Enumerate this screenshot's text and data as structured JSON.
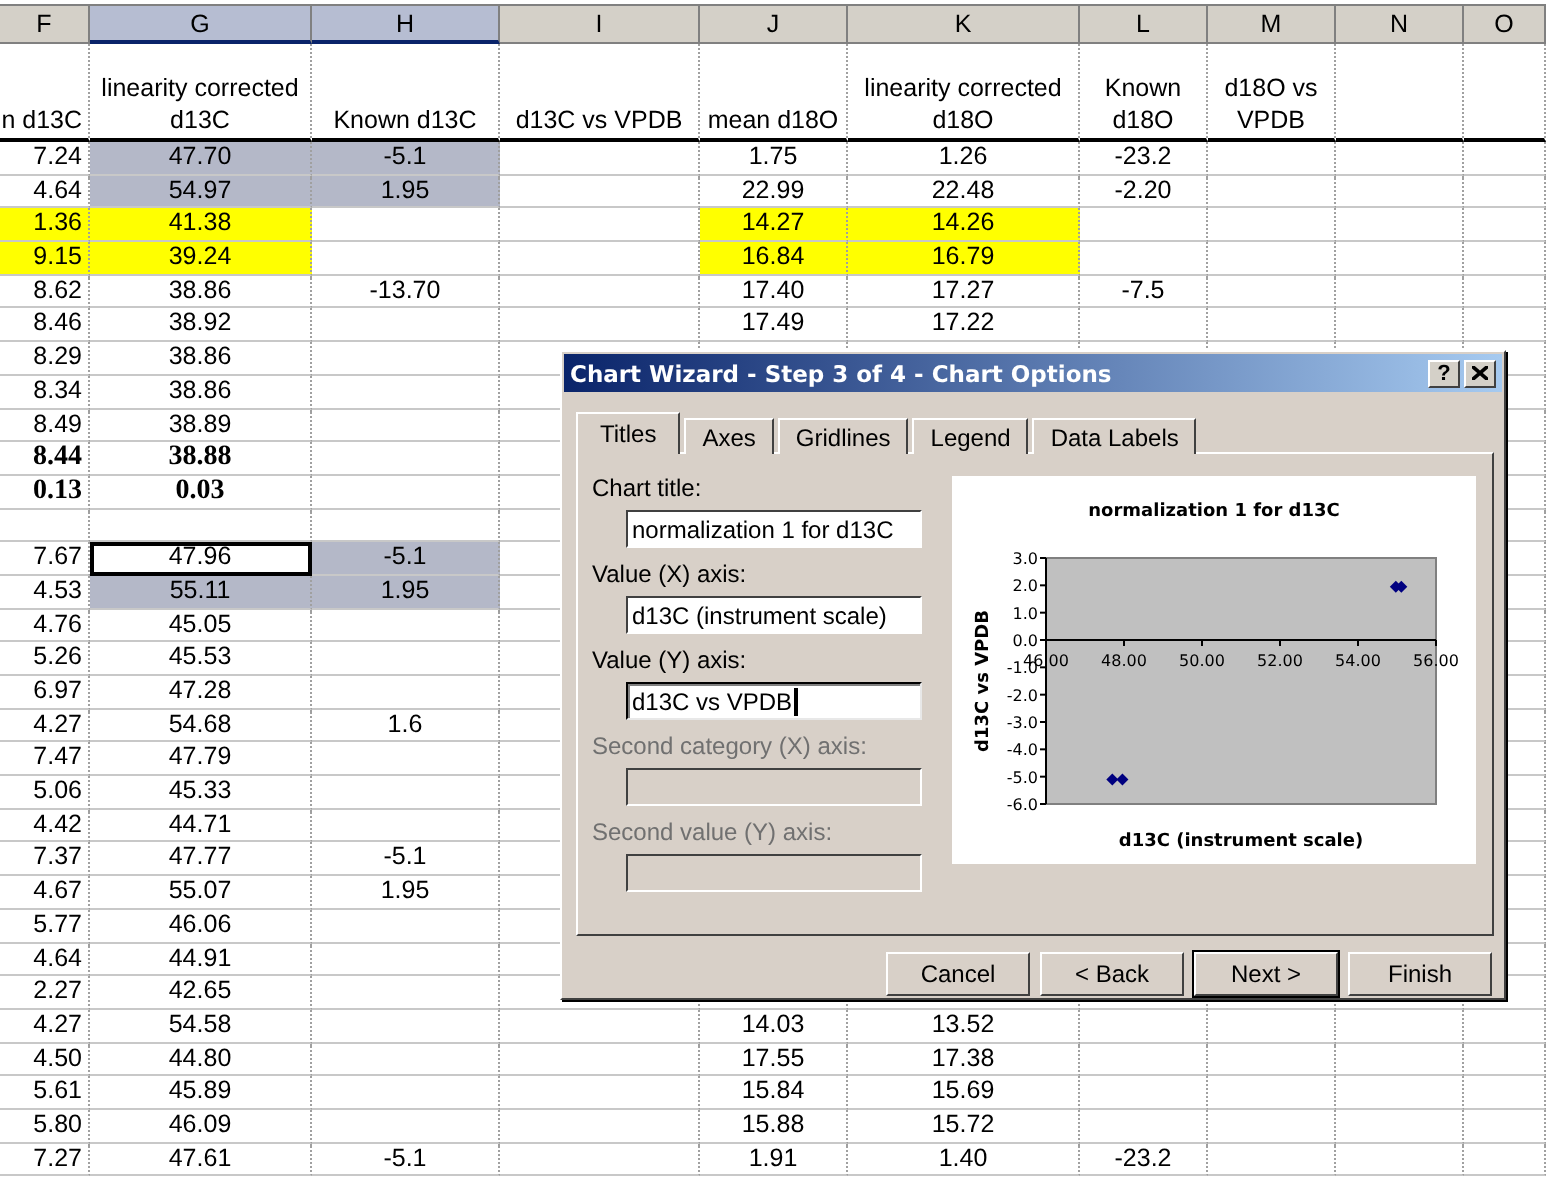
{
  "sheet": {
    "columns": [
      {
        "label": "F",
        "selected": false
      },
      {
        "label": "G",
        "selected": true
      },
      {
        "label": "H",
        "selected": true
      },
      {
        "label": "I",
        "selected": false
      },
      {
        "label": "J",
        "selected": false
      },
      {
        "label": "K",
        "selected": false
      },
      {
        "label": "L",
        "selected": false
      },
      {
        "label": "M",
        "selected": false
      },
      {
        "label": "N",
        "selected": false
      },
      {
        "label": "O",
        "selected": false
      }
    ],
    "headings": {
      "F": "n d13C",
      "G": "linearity corrected d13C",
      "H": "Known d13C",
      "I": "d13C vs VPDB",
      "J": "mean d18O",
      "K": "linearity corrected d18O",
      "L": "Known d18O",
      "M": "d18O vs VPDB"
    },
    "rows": [
      {
        "kind": "data",
        "cells": {
          "F": {
            "text": "7.24"
          },
          "G": {
            "text": "47.70",
            "in_range": true
          },
          "H": {
            "text": "-5.1",
            "in_range": true
          },
          "J": {
            "text": "1.75"
          },
          "K": {
            "text": "1.26"
          },
          "L": {
            "text": "-23.2"
          }
        }
      },
      {
        "kind": "data",
        "cells": {
          "F": {
            "text": "4.64"
          },
          "G": {
            "text": "54.97",
            "in_range": true
          },
          "H": {
            "text": "1.95",
            "in_range": true
          },
          "J": {
            "text": "22.99"
          },
          "K": {
            "text": "22.48"
          },
          "L": {
            "text": "-2.20"
          }
        }
      },
      {
        "kind": "data",
        "cells": {
          "F": {
            "text": "1.36",
            "color": "#ffff00"
          },
          "G": {
            "text": "41.38",
            "color": "#ffff00"
          },
          "J": {
            "text": "14.27",
            "color": "#ffff00"
          },
          "K": {
            "text": "14.26",
            "color": "#ffff00"
          }
        }
      },
      {
        "kind": "data",
        "cells": {
          "F": {
            "text": "9.15",
            "color": "#ffff00"
          },
          "G": {
            "text": "39.24",
            "color": "#ffff00"
          },
          "J": {
            "text": "16.84",
            "color": "#ffff00"
          },
          "K": {
            "text": "16.79",
            "color": "#ffff00"
          }
        }
      },
      {
        "kind": "data",
        "cells": {
          "F": {
            "text": "8.62"
          },
          "G": {
            "text": "38.86"
          },
          "H": {
            "text": "-13.70"
          },
          "J": {
            "text": "17.40"
          },
          "K": {
            "text": "17.27"
          },
          "L": {
            "text": "-7.5"
          }
        }
      },
      {
        "kind": "data",
        "cells": {
          "F": {
            "text": "8.46"
          },
          "G": {
            "text": "38.92"
          },
          "J": {
            "text": "17.49"
          },
          "K": {
            "text": "17.22"
          }
        }
      },
      {
        "kind": "data",
        "cells": {
          "F": {
            "text": "8.29"
          },
          "G": {
            "text": "38.86"
          }
        }
      },
      {
        "kind": "data",
        "cells": {
          "F": {
            "text": "8.34"
          },
          "G": {
            "text": "38.86"
          }
        }
      },
      {
        "kind": "data",
        "cells": {
          "F": {
            "text": "8.49"
          },
          "G": {
            "text": "38.89"
          }
        }
      },
      {
        "kind": "bold",
        "cells": {
          "F": {
            "text": "8.44"
          },
          "G": {
            "text": "38.88"
          }
        }
      },
      {
        "kind": "bold",
        "cells": {
          "F": {
            "text": "0.13"
          },
          "G": {
            "text": "0.03"
          }
        }
      },
      {
        "kind": "blank"
      },
      {
        "kind": "data",
        "cells": {
          "F": {
            "text": "7.67"
          },
          "G": {
            "text": "47.96",
            "active": true
          },
          "H": {
            "text": "-5.1",
            "in_range": true
          }
        }
      },
      {
        "kind": "data",
        "cells": {
          "F": {
            "text": "4.53"
          },
          "G": {
            "text": "55.11",
            "in_range": true
          },
          "H": {
            "text": "1.95",
            "in_range": true
          }
        }
      },
      {
        "kind": "data",
        "cells": {
          "F": {
            "text": "4.76"
          },
          "G": {
            "text": "45.05"
          }
        }
      },
      {
        "kind": "data",
        "cells": {
          "F": {
            "text": "5.26"
          },
          "G": {
            "text": "45.53"
          }
        }
      },
      {
        "kind": "data",
        "cells": {
          "F": {
            "text": "6.97"
          },
          "G": {
            "text": "47.28"
          }
        }
      },
      {
        "kind": "data",
        "cells": {
          "F": {
            "text": "4.27"
          },
          "G": {
            "text": "54.68"
          },
          "H": {
            "text": "1.6"
          }
        }
      },
      {
        "kind": "data",
        "cells": {
          "F": {
            "text": "7.47"
          },
          "G": {
            "text": "47.79"
          }
        }
      },
      {
        "kind": "data",
        "cells": {
          "F": {
            "text": "5.06"
          },
          "G": {
            "text": "45.33"
          }
        }
      },
      {
        "kind": "data",
        "cells": {
          "F": {
            "text": "4.42"
          },
          "G": {
            "text": "44.71"
          }
        }
      },
      {
        "kind": "data",
        "cells": {
          "F": {
            "text": "7.37"
          },
          "G": {
            "text": "47.77"
          },
          "H": {
            "text": "-5.1"
          }
        }
      },
      {
        "kind": "data",
        "cells": {
          "F": {
            "text": "4.67"
          },
          "G": {
            "text": "55.07"
          },
          "H": {
            "text": "1.95"
          }
        }
      },
      {
        "kind": "data",
        "cells": {
          "F": {
            "text": "5.77"
          },
          "G": {
            "text": "46.06"
          }
        }
      },
      {
        "kind": "data",
        "cells": {
          "F": {
            "text": "4.64"
          },
          "G": {
            "text": "44.91"
          }
        }
      },
      {
        "kind": "data",
        "cells": {
          "F": {
            "text": "2.27"
          },
          "G": {
            "text": "42.65"
          }
        }
      },
      {
        "kind": "data",
        "cells": {
          "F": {
            "text": "4.27"
          },
          "G": {
            "text": "54.58"
          },
          "J": {
            "text": "14.03"
          },
          "K": {
            "text": "13.52"
          }
        }
      },
      {
        "kind": "data",
        "cells": {
          "F": {
            "text": "4.50"
          },
          "G": {
            "text": "44.80"
          },
          "J": {
            "text": "17.55"
          },
          "K": {
            "text": "17.38"
          }
        }
      },
      {
        "kind": "data",
        "cells": {
          "F": {
            "text": "5.61"
          },
          "G": {
            "text": "45.89"
          },
          "J": {
            "text": "15.84"
          },
          "K": {
            "text": "15.69"
          }
        }
      },
      {
        "kind": "data",
        "cells": {
          "F": {
            "text": "5.80"
          },
          "G": {
            "text": "46.09"
          },
          "J": {
            "text": "15.88"
          },
          "K": {
            "text": "15.72"
          }
        }
      },
      {
        "kind": "data",
        "cells": {
          "F": {
            "text": "7.27"
          },
          "G": {
            "text": "47.61"
          },
          "H": {
            "text": "-5.1"
          },
          "J": {
            "text": "1.91"
          },
          "K": {
            "text": "1.40"
          },
          "L": {
            "text": "-23.2"
          }
        }
      }
    ]
  },
  "dialog": {
    "title": "Chart Wizard - Step 3 of 4 - Chart Options",
    "help_button": "?",
    "tabs": [
      {
        "label": "Titles",
        "selected": true
      },
      {
        "label": "Axes",
        "selected": false
      },
      {
        "label": "Gridlines",
        "selected": false
      },
      {
        "label": "Legend",
        "selected": false
      },
      {
        "label": "Data Labels",
        "selected": false
      }
    ],
    "fields": [
      {
        "label": "Chart title:",
        "value": "normalization 1 for d13C",
        "disabled": false,
        "focused": false
      },
      {
        "label": "Value (X) axis:",
        "value": "d13C (instrument scale)",
        "disabled": false,
        "focused": false
      },
      {
        "label": "Value (Y) axis:",
        "value": "d13C vs VPDB",
        "disabled": false,
        "focused": true
      },
      {
        "label": "Second category (X) axis:",
        "disabled": true,
        "focused": false
      },
      {
        "label": "Second value (Y) axis:",
        "disabled": true,
        "focused": false
      }
    ],
    "chart_data": {
      "type": "scatter",
      "title": "normalization 1 for d13C",
      "xlabel": "d13C (instrument scale)",
      "ylabel": "d13C vs VPDB",
      "x": [
        47.7,
        47.96,
        54.97,
        55.11
      ],
      "series": [
        {
          "color": "#000080",
          "values": [
            -5.1,
            -5.1,
            1.95,
            1.95
          ]
        }
      ],
      "xlim": [
        46,
        56
      ],
      "ylim": [
        -6,
        3
      ],
      "xticks": [
        {
          "value": 46,
          "label": "46.00"
        },
        {
          "value": 48,
          "label": "48.00"
        },
        {
          "value": 50,
          "label": "50.00"
        },
        {
          "value": 52,
          "label": "52.00"
        },
        {
          "value": 54,
          "label": "54.00"
        },
        {
          "value": 56,
          "label": "56.00"
        }
      ],
      "yticks": [
        {
          "value": 3,
          "label": "3.0"
        },
        {
          "value": 2,
          "label": "2.0"
        },
        {
          "value": 1,
          "label": "1.0"
        },
        {
          "value": 0,
          "label": "0.0"
        },
        {
          "value": -1,
          "label": "-1.0"
        },
        {
          "value": -2,
          "label": "-2.0"
        },
        {
          "value": -3,
          "label": "-3.0"
        },
        {
          "value": -4,
          "label": "-4.0"
        },
        {
          "value": -5,
          "label": "-5.0"
        },
        {
          "value": -6,
          "label": "-6.0"
        }
      ]
    },
    "buttons": [
      {
        "label": "Cancel",
        "default": false
      },
      {
        "label": "< Back",
        "default": false
      },
      {
        "label": "Next >",
        "default": true
      },
      {
        "label": "Finish",
        "default": false
      }
    ]
  }
}
